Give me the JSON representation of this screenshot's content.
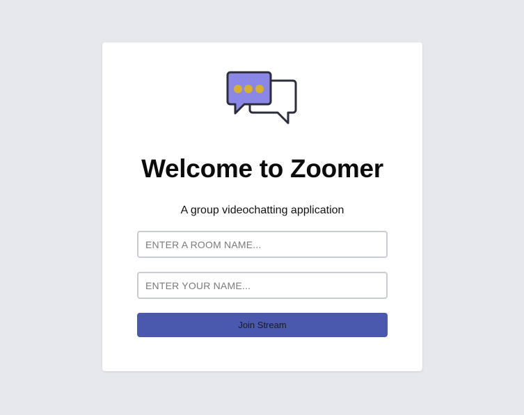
{
  "app": {
    "title": "Welcome to Zoomer",
    "subtitle": "A group videochatting application"
  },
  "logo": {
    "icon": "chat-bubbles-icon",
    "bubble_color": "#8b87e6",
    "dot_color": "#d8b12c",
    "outline_color": "#2b2d3a"
  },
  "form": {
    "room_placeholder": "ENTER A ROOM NAME...",
    "room_value": "",
    "name_placeholder": "ENTER YOUR NAME...",
    "name_value": "",
    "join_label": "Join Stream",
    "join_color": "#4a59ae"
  }
}
